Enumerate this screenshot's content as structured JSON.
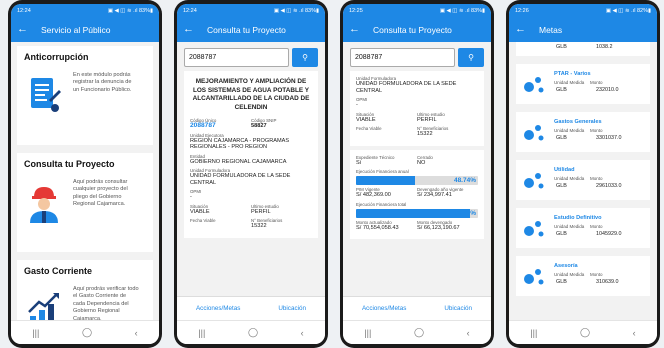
{
  "screens": [
    {
      "status": {
        "time": "12:24",
        "right": "▣ ◀ ◫ ≋ .ıl 83%▮"
      },
      "title": "Servicio al Público",
      "cards": [
        {
          "heading": "Anticorrupción",
          "text": "En este módulo podrás registrar la denuncia de un Funcionario Público."
        },
        {
          "heading": "Consulta tu Proyecto",
          "text": "Aquí podrás consultar cualquier proyecto del pliego del Gobierno Regional Cajamarca."
        },
        {
          "heading": "Gasto Corriente",
          "text": "Aquí prodrás verificar todo el Gasto Corriente de cada Dependencia del Gobierno Regional Cajamarca."
        }
      ]
    },
    {
      "status": {
        "time": "12:24",
        "right": "▣ ◀ ◫ ≋ .ıl 83%▮"
      },
      "title": "Consulta tu Proyecto",
      "search_value": "2088787",
      "project_title": "MEJORAMIENTO Y AMPLIACIÓN DE LOS SISTEMAS DE AGUA POTABLE Y ALCANTARILLADO DE LA CIUDAD DE CELENDIN",
      "fields": {
        "codigo_unico_label": "Código Único",
        "codigo_unico": "2088787",
        "codigo_snip_label": "Código SNIP",
        "codigo_snip": "58827",
        "unidad_ejecutora_label": "Unidad Ejecutora",
        "unidad_ejecutora": "REGION CAJAMARCA - PROGRAMAS REGIONALES - PRO REGION",
        "entidad_label": "Entidad",
        "entidad": "GOBIERNO REGIONAL CAJAMARCA",
        "unidad_formuladora_label": "Unidad Formuladora",
        "unidad_formuladora": "UNIDAD FORMULADORA DE LA SEDE CENTRAL",
        "opmi_label": "OPMI",
        "opmi": "-",
        "situacion_label": "Situación",
        "situacion": "VIABLE",
        "ultimo_estudio_label": "Ultimo estudio",
        "ultimo_estudio": "PERFIL",
        "fecha_viable_label": "Fecha Viable",
        "fecha_viable": "",
        "beneficiarios_label": "N° Beneficiarios",
        "beneficiarios": "15322"
      },
      "actions": {
        "metas": "Acciones/Metas",
        "ubicacion": "Ubicación"
      }
    },
    {
      "status": {
        "time": "12:25",
        "right": "▣ ◀ ◫ ≋ .ıl 83%▮"
      },
      "title": "Consulta tu Proyecto",
      "search_value": "2088787",
      "fields": {
        "unidad_formuladora_label": "Unidad Formuladora",
        "unidad_formuladora": "UNIDAD FORMULADORA DE LA SEDE CENTRAL",
        "opmi_label": "OPMI",
        "opmi": "-",
        "situacion_label": "Situación",
        "situacion": "VIABLE",
        "ultimo_estudio_label": "Ultimo estudio",
        "ultimo_estudio": "PERFIL",
        "fecha_viable_label": "Fecha Viable",
        "fecha_viable": "",
        "beneficiarios_label": "N° Beneficiarios",
        "beneficiarios": "15322",
        "expediente_label": "Expediente Técnico",
        "expediente": "Si",
        "cerrado_label": "Cerrado",
        "cerrado": "NO",
        "ejec_anual_label": "Ejecución Financiera anual",
        "ejec_anual_pct": "48.74%",
        "ejec_anual_value": 48.74,
        "pim_label": "PIM Vigente",
        "pim": "S/ 482,369.00",
        "devengado_anio_label": "Devengado año vigente",
        "devengado_anio": "S/ 234,997.41",
        "ejec_total_label": "Ejecución Financiera total",
        "ejec_total_pct": "93.72%",
        "ejec_total_value": 93.72,
        "monto_act_label": "Monto actualizado",
        "monto_act": "S/ 70,554,058.43",
        "monto_dev_label": "Monto devengado",
        "monto_dev": "S/ 66,123,190.67"
      },
      "actions": {
        "metas": "Acciones/Metas",
        "ubicacion": "Ubicación"
      }
    },
    {
      "status": {
        "time": "12:26",
        "right": "▣ ◀ ◫ ≋ .ıl 82%▮"
      },
      "title": "Metas",
      "partial": {
        "um": "GLB",
        "monto": "1038.2"
      },
      "metas": [
        {
          "name": "PTAR - Varios",
          "um_label": "Unidad Medida",
          "monto_label": "Monto",
          "um": "GLB",
          "monto": "232010.0"
        },
        {
          "name": "Gastos Generales",
          "um_label": "Unidad Medida",
          "monto_label": "Monto",
          "um": "GLB",
          "monto": "3301037.0"
        },
        {
          "name": "Utilidad",
          "um_label": "Unidad Medida",
          "monto_label": "Monto",
          "um": "GLB",
          "monto": "2961033.0"
        },
        {
          "name": "Estudio Definitivo",
          "um_label": "Unidad Medida",
          "monto_label": "Monto",
          "um": "GLB",
          "monto": "1045929.0"
        },
        {
          "name": "Asesoría",
          "um_label": "Unidad Medida",
          "monto_label": "Monto",
          "um": "GLB",
          "monto": "310639.0"
        }
      ]
    }
  ],
  "nav": {
    "recents": "|||",
    "home": "◯",
    "back": "‹"
  },
  "colors": {
    "primary": "#1e88e5",
    "accent": "#e53935",
    "navy": "#1a3f7a"
  }
}
